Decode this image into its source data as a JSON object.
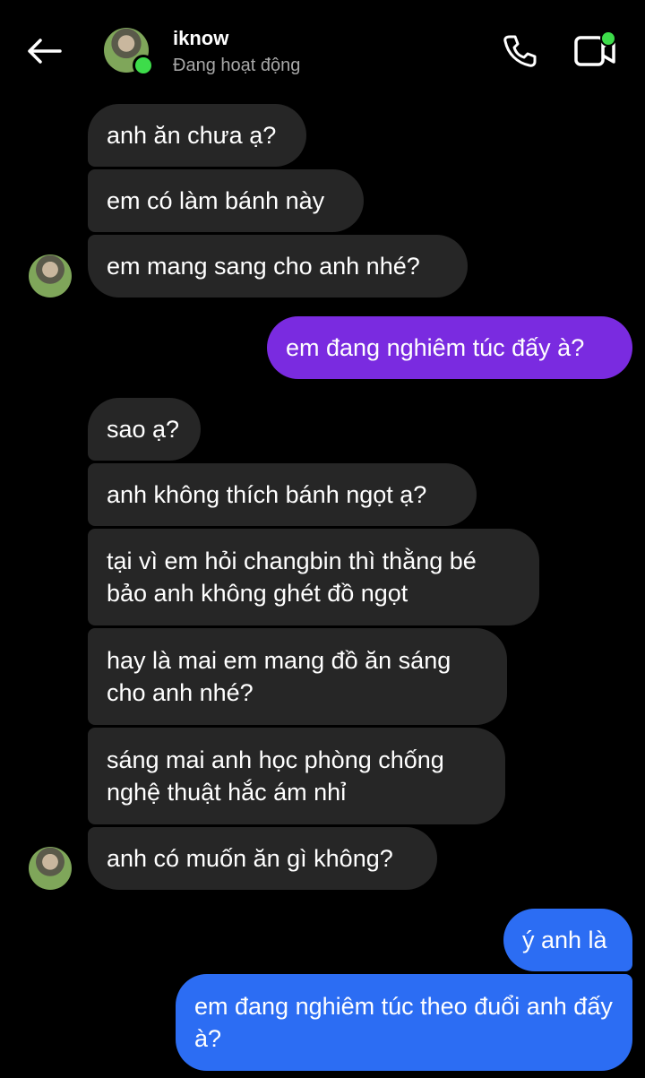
{
  "header": {
    "name": "iknow",
    "status": "Đang hoạt động",
    "back_icon": "arrow-left-icon",
    "call_icon": "phone-icon",
    "video_icon": "video-camera-icon",
    "status_color": "#3ddc4a"
  },
  "messages": [
    {
      "from": "them",
      "text": "anh ăn chưa ạ?"
    },
    {
      "from": "them",
      "text": "em có làm bánh này"
    },
    {
      "from": "them",
      "text": "em mang sang cho anh nhé?"
    },
    {
      "from": "me",
      "text": "em đang nghiêm túc đấy à?"
    },
    {
      "from": "them",
      "text": "sao ạ?"
    },
    {
      "from": "them",
      "text": "anh không thích bánh ngọt ạ?"
    },
    {
      "from": "them",
      "text": "tại vì em hỏi changbin thì thằng bé bảo anh không ghét đồ ngọt"
    },
    {
      "from": "them",
      "text": "hay là mai em mang đồ ăn sáng cho anh nhé?"
    },
    {
      "from": "them",
      "text": "sáng mai anh học phòng chống nghệ thuật hắc ám nhỉ"
    },
    {
      "from": "them",
      "text": "anh có muốn ăn gì không?"
    },
    {
      "from": "me",
      "text": "ý anh là"
    },
    {
      "from": "me",
      "text": "em đang nghiêm túc theo đuổi anh đấy à?"
    }
  ],
  "colors": {
    "background": "#000000",
    "incoming_bubble": "#262626",
    "outgoing_purple": "#7a2be0",
    "outgoing_blue": "#2c6df3"
  }
}
